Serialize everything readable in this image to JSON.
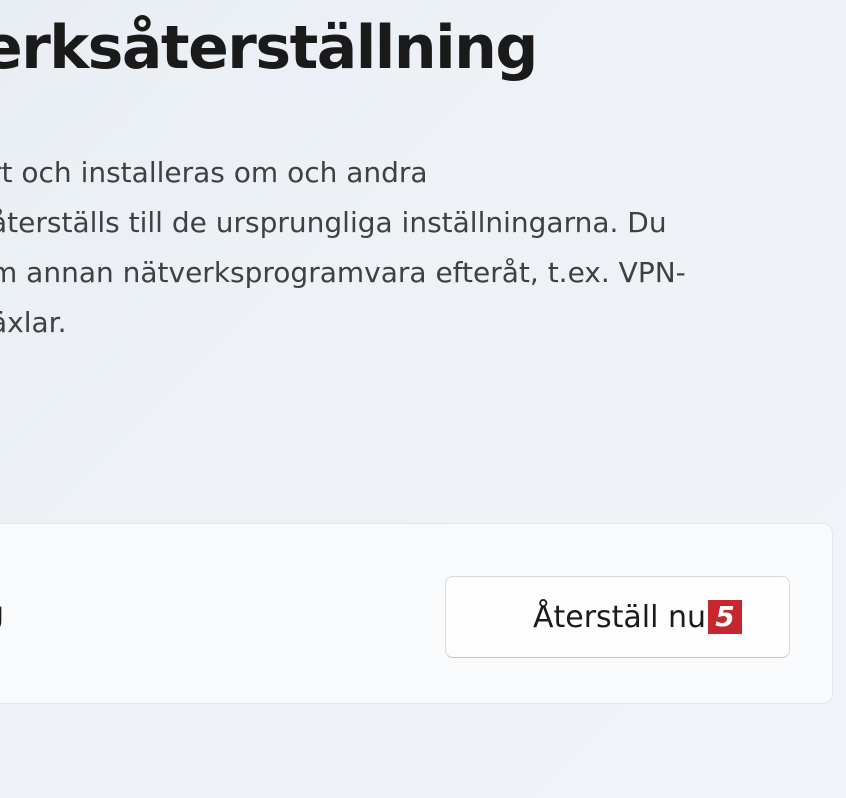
{
  "page": {
    "title": "erksåterställning",
    "description_lines": [
      "rt och installeras om och andra",
      "återställs till de ursprungliga inställningarna. Du",
      "m annan nätverksprogramvara efteråt, t.ex. VPN-",
      "äxlar."
    ]
  },
  "reset_card": {
    "label": "g",
    "button_label": "Återställ nu",
    "step_badge": "5",
    "badge_color": "#c6262e"
  }
}
